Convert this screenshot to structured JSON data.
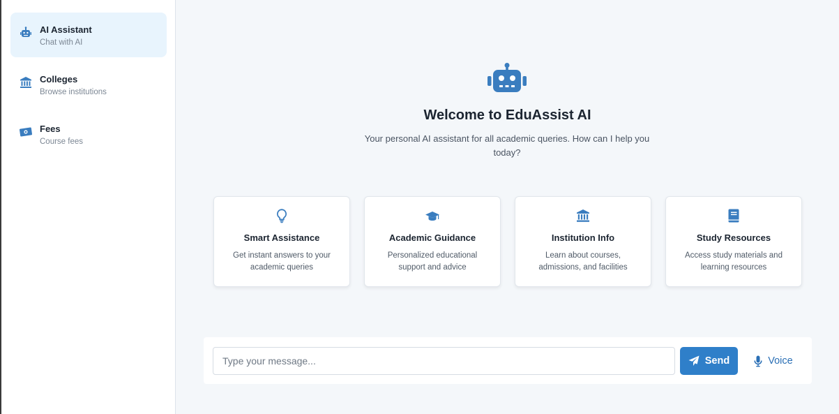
{
  "colors": {
    "accent": "#2f7fc9",
    "icon": "#3a7dbf",
    "active_bg": "#e8f4fd"
  },
  "sidebar": {
    "items": [
      {
        "label": "AI Assistant",
        "sub": "Chat with AI",
        "icon": "robot-icon",
        "active": true
      },
      {
        "label": "Colleges",
        "sub": "Browse institutions",
        "icon": "institution-icon",
        "active": false
      },
      {
        "label": "Fees",
        "sub": "Course fees",
        "icon": "money-icon",
        "active": false
      }
    ]
  },
  "welcome": {
    "title": "Welcome to EduAssist AI",
    "subtitle": "Your personal AI assistant for all academic queries. How can I help you today?",
    "icon": "robot-icon"
  },
  "cards": [
    {
      "title": "Smart Assistance",
      "desc": "Get instant answers to your academic queries",
      "icon": "lightbulb-icon"
    },
    {
      "title": "Academic Guidance",
      "desc": "Personalized educational support and advice",
      "icon": "graduation-cap-icon"
    },
    {
      "title": "Institution Info",
      "desc": "Learn about courses, admissions, and facilities",
      "icon": "institution-icon"
    },
    {
      "title": "Study Resources",
      "desc": "Access study materials and learning resources",
      "icon": "book-icon"
    }
  ],
  "composer": {
    "placeholder": "Type your message...",
    "value": "",
    "send_label": "Send",
    "voice_label": "Voice"
  }
}
